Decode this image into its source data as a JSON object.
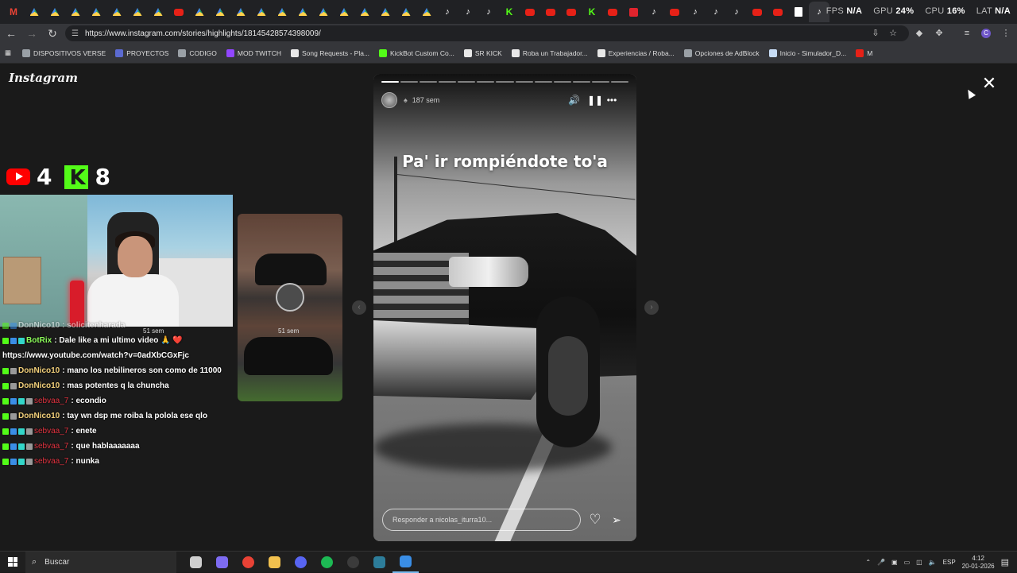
{
  "browser": {
    "tab_icons": [
      "gmail-icon",
      "drive-icon",
      "drive-icon",
      "drive-icon",
      "drive-icon",
      "drive-icon",
      "drive-icon",
      "drive-icon",
      "youtube-icon",
      "drive-icon",
      "drive-icon",
      "drive-icon",
      "drive-icon",
      "drive-icon",
      "drive-icon",
      "drive-icon",
      "drive-icon",
      "drive-icon",
      "drive-icon",
      "drive-icon",
      "drive-icon",
      "tiktok-icon",
      "tiktok-icon",
      "tiktok-icon",
      "kick-icon",
      "youtube-icon",
      "youtube-icon",
      "youtube-icon",
      "kick-icon",
      "youtube-icon",
      "red-app-icon",
      "tiktok-icon",
      "youtube-icon",
      "tiktok-icon",
      "tiktok-icon",
      "tiktok-icon",
      "youtube-icon",
      "youtube-icon",
      "doc-icon",
      "tiktok-icon"
    ],
    "fps_overlay": {
      "fps_label": "FPS",
      "fps_value": "N/A",
      "gpu_label": "GPU",
      "gpu_value": "24%",
      "cpu_label": "CPU",
      "cpu_value": "16%",
      "lat_label": "LAT",
      "lat_value": "N/A"
    },
    "url": "https://www.instagram.com/stories/highlights/18145428574398009/",
    "bookmarks": [
      {
        "label": "DISPOSITIVOS VERSE",
        "color": "#9aa0a6"
      },
      {
        "label": "PROYECTOS",
        "color": "#5b6ad0"
      },
      {
        "label": "CODIGO",
        "color": "#9aa0a6"
      },
      {
        "label": "MOD TWITCH",
        "color": "#9146ff"
      },
      {
        "label": "Song Requests - Pla...",
        "color": "#e8e8e8"
      },
      {
        "label": "KickBot Custom Co...",
        "color": "#53fc18"
      },
      {
        "label": "SR KICK",
        "color": "#e8e8e8"
      },
      {
        "label": "Roba un Trabajador...",
        "color": "#e8e8e8"
      },
      {
        "label": "Experiencias / Roba...",
        "color": "#e8e8e8"
      },
      {
        "label": "Opciones de AdBlock",
        "color": "#9aa0a6"
      },
      {
        "label": "Inicio - Simulador_D...",
        "color": "#c7dcf5"
      },
      {
        "label": "M",
        "color": "#e62117"
      }
    ]
  },
  "instagram": {
    "logo": "Instagram",
    "story": {
      "time": "187 sem",
      "caption": "Pa' ir rompiéndote to'a",
      "reply_placeholder": "Responder a nicolas_iturra10...",
      "progress_total": 13,
      "progress_done": 1
    },
    "prev_story": {
      "time": "51 sem",
      "overlay_time": "51 sem"
    }
  },
  "stream_overlay": {
    "youtube_count": "4",
    "kick_count": "8",
    "chat": [
      {
        "user": "",
        "user_class": "",
        "badges": [
          "b-green",
          "b-blue"
        ],
        "text": "DonNico10 : solicitenharada",
        "faded": true
      },
      {
        "user": "BotRix",
        "user_class": "user-green",
        "badges": [
          "b-green",
          "b-blue",
          "b-teal"
        ],
        "text": ": Dale like a mi ultimo video 🙏 ❤️"
      },
      {
        "user": "",
        "user_class": "",
        "badges": [],
        "text": "https://www.youtube.com/watch?v=0adXbCGxFjc"
      },
      {
        "user": "DonNico10",
        "user_class": "user-yellow",
        "badges": [
          "b-green",
          "b-gray"
        ],
        "text": ": mano los nebilineros son como de 11000"
      },
      {
        "user": "DonNico10",
        "user_class": "user-yellow",
        "badges": [
          "b-green",
          "b-gray"
        ],
        "text": ": mas potentes q la chuncha"
      },
      {
        "user": "sebvaa_7",
        "user_class": "user-red",
        "badges": [
          "b-green",
          "b-blue",
          "b-teal",
          "b-gray"
        ],
        "text": ": econdio"
      },
      {
        "user": "DonNico10",
        "user_class": "user-yellow",
        "badges": [
          "b-green",
          "b-gray"
        ],
        "text": ": tay wn dsp me roiba la polola ese qlo"
      },
      {
        "user": "sebvaa_7",
        "user_class": "user-red",
        "badges": [
          "b-green",
          "b-blue",
          "b-teal",
          "b-gray"
        ],
        "text": ": enete"
      },
      {
        "user": "sebvaa_7",
        "user_class": "user-red",
        "badges": [
          "b-green",
          "b-blue",
          "b-teal",
          "b-gray"
        ],
        "text": ": que hablaaaaaaa"
      },
      {
        "user": "sebvaa_7",
        "user_class": "user-red",
        "badges": [
          "b-green",
          "b-blue",
          "b-teal",
          "b-gray"
        ],
        "text": ": nunka"
      }
    ]
  },
  "taskbar": {
    "search_label": "Buscar",
    "apps": [
      {
        "name": "task-view-icon",
        "color": "#cfcfcf"
      },
      {
        "name": "copilot-icon",
        "color": "#7e6cf2"
      },
      {
        "name": "chrome-icon",
        "color": "#e94235"
      },
      {
        "name": "file-explorer-icon",
        "color": "#f2c14e"
      },
      {
        "name": "discord-icon",
        "color": "#5865f2"
      },
      {
        "name": "spotify-icon",
        "color": "#1db954"
      },
      {
        "name": "obs-icon",
        "color": "#3b3b3b"
      },
      {
        "name": "app-icon",
        "color": "#2d7d9a"
      },
      {
        "name": "active-app-icon",
        "color": "#3a8ee6"
      }
    ],
    "language": "ESP",
    "time": "4:12",
    "date": "20-01-2026"
  }
}
